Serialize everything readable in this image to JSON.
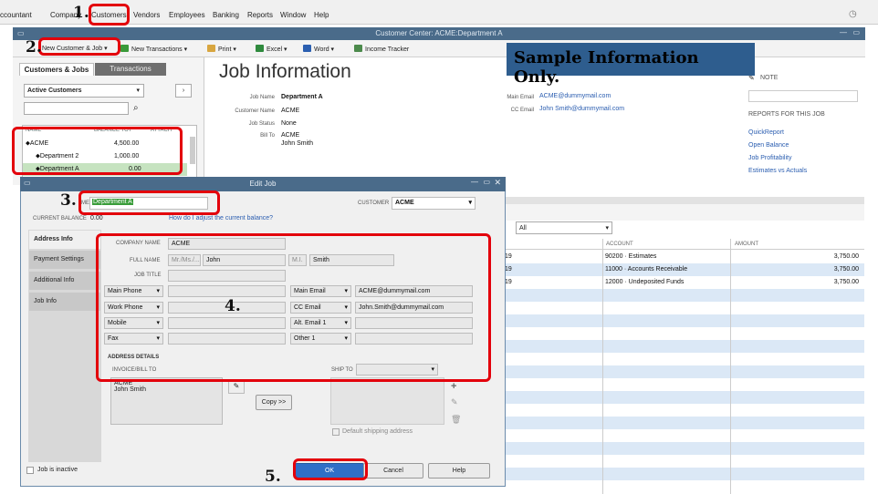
{
  "menubar": {
    "items": [
      "ccountant",
      "Company",
      "Customers",
      "Vendors",
      "Employees",
      "Banking",
      "Reports",
      "Window",
      "Help"
    ]
  },
  "window": {
    "title": "Customer Center: ACME:Department A"
  },
  "toolbar": {
    "new_customer_job": "New Customer & Job ▾",
    "new_transactions": "New Transactions ▾",
    "print": "Print ▾",
    "excel": "Excel ▾",
    "word": "Word ▾",
    "income_tracker": "Income Tracker"
  },
  "left_pane": {
    "tabs": [
      "Customers & Jobs",
      "Transactions"
    ],
    "filter": "Active Customers",
    "columns": [
      "NAME",
      "BALANCE TOT",
      "ATTACH"
    ],
    "rows": [
      {
        "name": "⬥ACME",
        "balance": "4,500.00"
      },
      {
        "name": "⬥Department 2",
        "balance": "1,000.00"
      },
      {
        "name": "⬥Department A",
        "balance": "0.00"
      }
    ]
  },
  "job_info": {
    "heading": "Job Information",
    "labels": {
      "job_name": "Job Name",
      "customer_name": "Customer Name",
      "job_status": "Job Status",
      "bill_to": "Bill To",
      "main_email": "Main Email",
      "cc_email": "CC Email"
    },
    "job_name": "Department A",
    "customer_name": "ACME",
    "job_status": "None",
    "bill_to_1": "ACME",
    "bill_to_2": "John Smith",
    "main_email": "ACME@dummymail.com",
    "cc_email": "John Smith@dummymail.com"
  },
  "sidebar": {
    "note": "NOTE",
    "reports_header": "REPORTS FOR THIS JOB",
    "reports": [
      "QuickReport",
      "Open Balance",
      "Job Profitability",
      "Estimates vs Actuals"
    ]
  },
  "sample_banner": "Sample Information Only.",
  "transactions": {
    "filter": "All",
    "columns": [
      "ACCOUNT",
      "AMOUNT"
    ],
    "rows": [
      {
        "num": "19",
        "account": "90200 · Estimates",
        "amount": "3,750.00"
      },
      {
        "num": "19",
        "account": "11000 · Accounts Receivable",
        "amount": "3,750.00"
      },
      {
        "num": "19",
        "account": "12000 · Undeposited Funds",
        "amount": "3,750.00"
      }
    ]
  },
  "dialog": {
    "title": "Edit Job",
    "job_name_label": "ME",
    "job_name_value": "Department A",
    "customer_label": "CUSTOMER",
    "customer_value": "ACME",
    "current_balance_label": "CURRENT BALANCE",
    "current_balance_value": "0.00",
    "adjust_link": "How do I adjust the current balance?",
    "side_tabs": [
      "Address Info",
      "Payment Settings",
      "Additional Info",
      "Job Info"
    ],
    "company_name_label": "COMPANY NAME",
    "company_name": "ACME",
    "full_name_label": "FULL NAME",
    "salutation": "Mr./Ms./...",
    "first_name": "John",
    "mi": "M.I.",
    "last_name": "Smith",
    "job_title_label": "JOB TITLE",
    "phones": [
      "Main Phone",
      "Work Phone",
      "Mobile",
      "Fax"
    ],
    "emails": [
      "Main Email",
      "CC Email",
      "Alt. Email 1",
      "Other 1"
    ],
    "email_values": [
      "ACME@dummymail.com",
      "John.Smith@dummymail.com",
      "",
      ""
    ],
    "address_details": "ADDRESS DETAILS",
    "invoice_bill_to": "INVOICE/BILL TO",
    "ship_to": "SHIP TO",
    "bill_address_1": "ACME",
    "bill_address_2": "John Smith",
    "copy_btn": "Copy >>",
    "default_shipping": "Default shipping address",
    "job_inactive": "Job is inactive",
    "ok": "OK",
    "cancel": "Cancel",
    "help": "Help"
  },
  "callouts": [
    "1.",
    "2.",
    "3.",
    "4.",
    "5."
  ]
}
